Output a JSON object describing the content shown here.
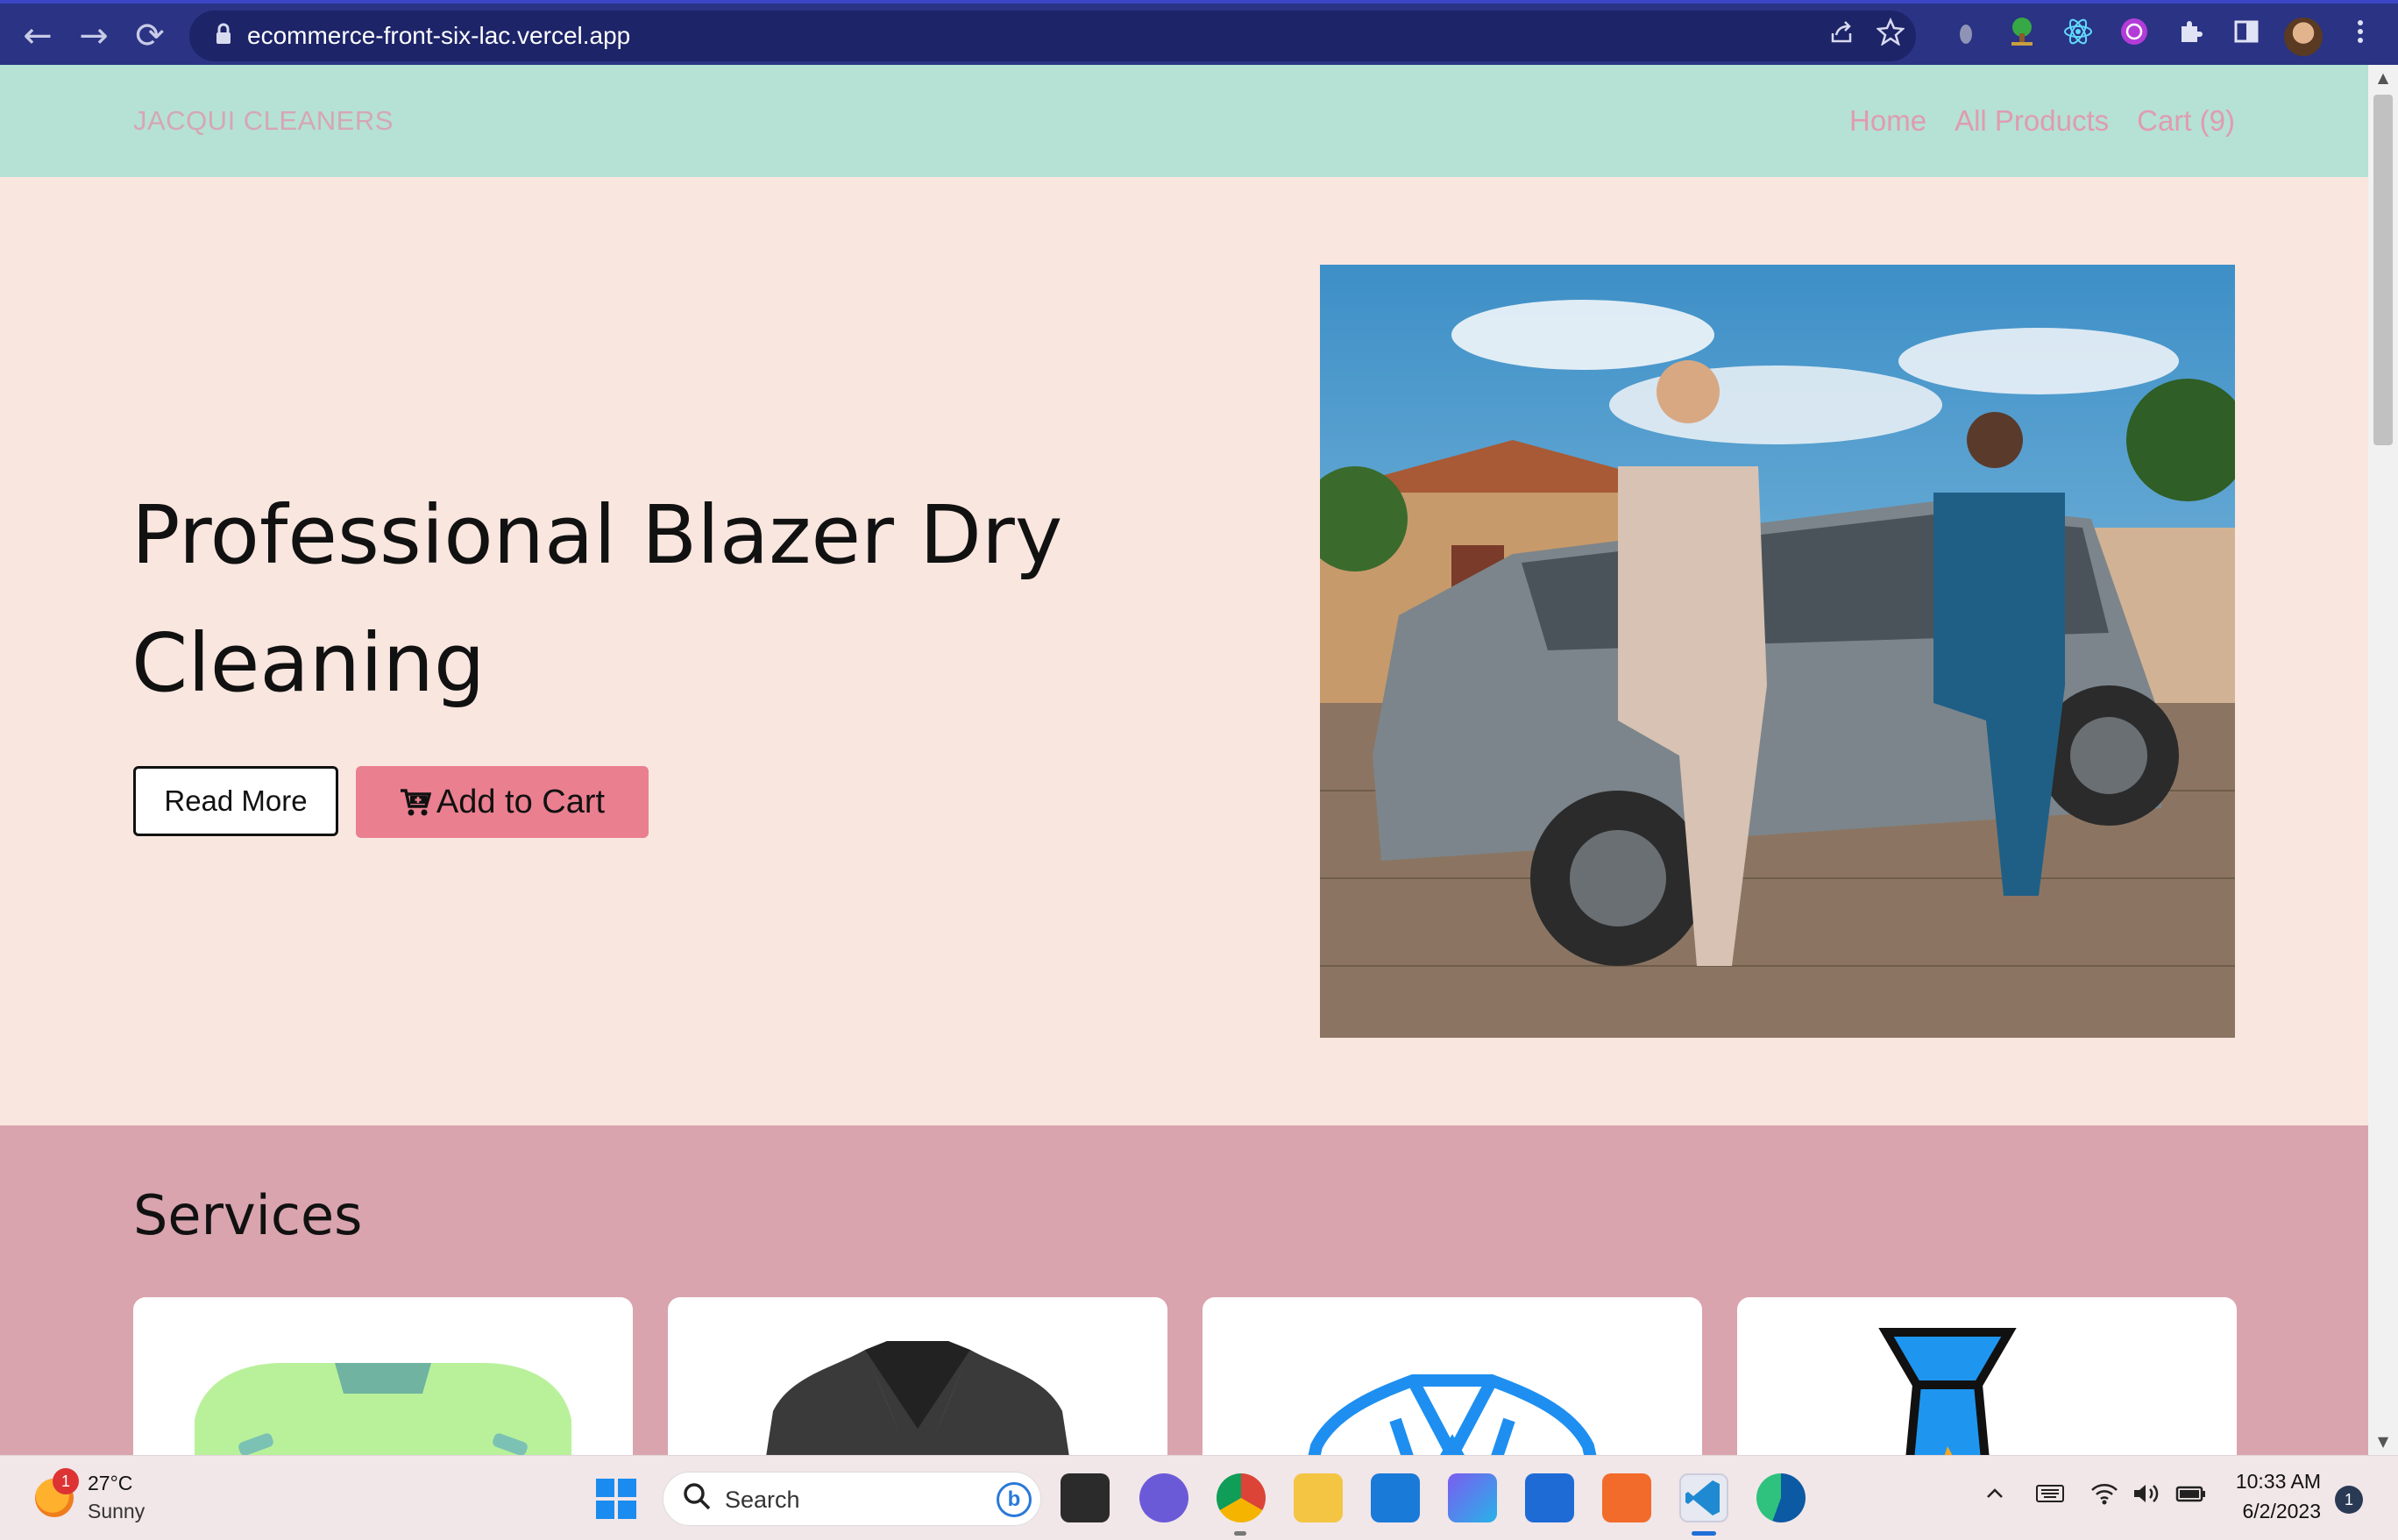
{
  "browser": {
    "url": "ecommerce-front-six-lac.vercel.app",
    "back_icon": "←",
    "forward_icon": "→",
    "reload_icon": "⟳"
  },
  "site": {
    "brand": "JACQUI CLEANERS",
    "nav": {
      "home": "Home",
      "all_products": "All Products",
      "cart": "Cart (9)"
    }
  },
  "hero": {
    "title": "Professional Blazer Dry Cleaning",
    "read_more": "Read More",
    "add_to_cart": "Add to Cart"
  },
  "services": {
    "title": "Services"
  },
  "taskbar": {
    "weather_temp": "27°C",
    "weather_cond": "Sunny",
    "weather_badge": "1",
    "search_placeholder": "Search",
    "time": "10:33 AM",
    "date": "6/2/2023",
    "notifications": "1"
  },
  "colors": {
    "browser_chrome": "#2a3384",
    "site_nav": "#b5e2d4",
    "hero_bg": "#f9e6df",
    "services_bg": "#d9a4ae",
    "cart_button": "#ea7f8f",
    "nav_link": "#e09bb0"
  }
}
